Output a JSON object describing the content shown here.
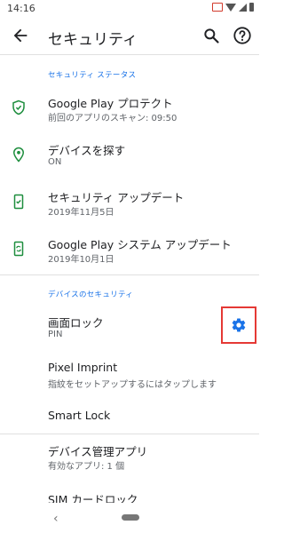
{
  "status_bar": {
    "time": "14:16",
    "icons": [
      "cast-icon",
      "wifi-icon",
      "signal-icon",
      "battery-icon"
    ]
  },
  "app_bar": {
    "title": "セキュリティ",
    "actions": [
      "back-arrow-icon",
      "search-icon",
      "help-icon"
    ]
  },
  "section_security_status": {
    "header": "セキュリティ ステータス",
    "items": [
      {
        "title": "Google Play プロテクト",
        "subtitle": "前回のアプリのスキャン: 09:50",
        "icon": "shield-check-icon"
      },
      {
        "title": "デバイスを探す",
        "subtitle": "ON",
        "icon": "location-pin-icon"
      },
      {
        "title": "セキュリティ アップデート",
        "subtitle": "2019年11月5日",
        "icon": "phone-check-icon"
      },
      {
        "title": "Google Play システム アップデート",
        "subtitle": "2019年10月1日",
        "icon": "phone-sync-icon"
      }
    ]
  },
  "section_device_security": {
    "header": "デバイスのセキュリティ",
    "items": [
      {
        "title": "画面ロック",
        "subtitle": "PIN",
        "icon": "gear-icon"
      },
      {
        "title": "Pixel Imprint",
        "subtitle": "指紋をセットアップするにはタップします"
      },
      {
        "title": "Smart Lock"
      }
    ]
  },
  "more_items": [
    {
      "title": "デバイス管理アプリ",
      "subtitle": "有効なアプリ: 1 個"
    },
    {
      "title": "SIM カードロック"
    }
  ],
  "nav_bar": {
    "back_glyph": "‹"
  },
  "colors": {
    "accent": "#1a73e8",
    "icon_green": "#1e8e3e",
    "highlight_red": "#e53935"
  }
}
